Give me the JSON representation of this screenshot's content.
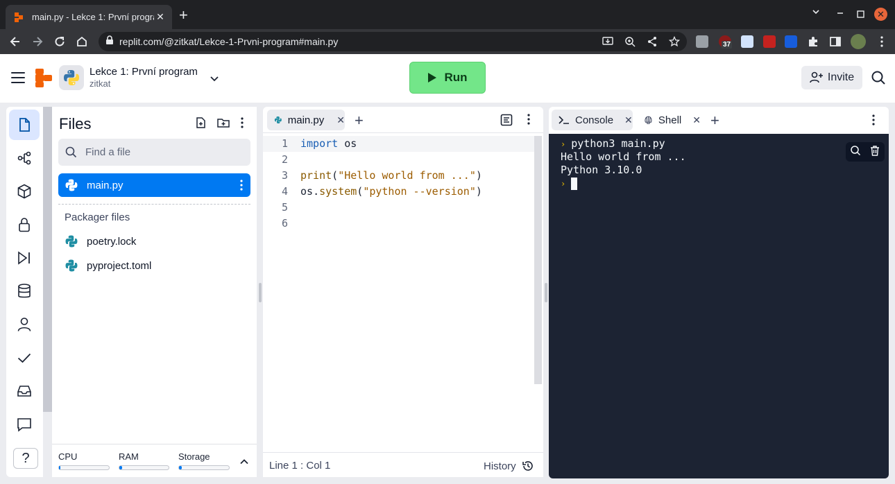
{
  "browser": {
    "tab_title": "main.py - Lekce 1: První progra",
    "url": "replit.com/@zitkat/Lekce-1-Prvni-program#main.py",
    "ext_badge": "37"
  },
  "header": {
    "repl_name": "Lekce 1: První program",
    "owner": "zitkat",
    "run_label": "Run",
    "invite_label": "Invite"
  },
  "files": {
    "title": "Files",
    "search_placeholder": "Find a file",
    "items": [
      {
        "name": "main.py"
      }
    ],
    "packager_label": "Packager files",
    "packager_items": [
      {
        "name": "poetry.lock"
      },
      {
        "name": "pyproject.toml"
      }
    ],
    "usage": {
      "cpu_label": "CPU",
      "cpu_fraction": 0.03,
      "ram_label": "RAM",
      "ram_fraction": 0.05,
      "storage_label": "Storage",
      "storage_fraction": 0.05
    }
  },
  "editor": {
    "tab_label": "main.py",
    "lines": [
      {
        "n": "1",
        "tokens": [
          {
            "t": "import",
            "c": "kw"
          },
          {
            "t": " os",
            "c": ""
          }
        ]
      },
      {
        "n": "2",
        "tokens": []
      },
      {
        "n": "3",
        "tokens": [
          {
            "t": "print",
            "c": "fn"
          },
          {
            "t": "(",
            "c": ""
          },
          {
            "t": "\"Hello world from ...\"",
            "c": "str"
          },
          {
            "t": ")",
            "c": ""
          }
        ]
      },
      {
        "n": "4",
        "tokens": [
          {
            "t": "os",
            "c": ""
          },
          {
            "t": ".",
            "c": ""
          },
          {
            "t": "system",
            "c": "fn"
          },
          {
            "t": "(",
            "c": ""
          },
          {
            "t": "\"python --version\"",
            "c": "str"
          },
          {
            "t": ")",
            "c": ""
          }
        ]
      },
      {
        "n": "5",
        "tokens": []
      },
      {
        "n": "6",
        "tokens": []
      }
    ],
    "status_position": "Line 1 : Col 1",
    "history_label": "History"
  },
  "console": {
    "tab_console": "Console",
    "tab_shell": "Shell",
    "command": "python3 main.py",
    "output": [
      "Hello world from ...",
      "Python 3.10.0"
    ]
  },
  "colors": {
    "run_green": "#73e689",
    "accent_blue": "#0079f2",
    "replit_orange": "#f26207",
    "console_bg": "#1c2333"
  }
}
